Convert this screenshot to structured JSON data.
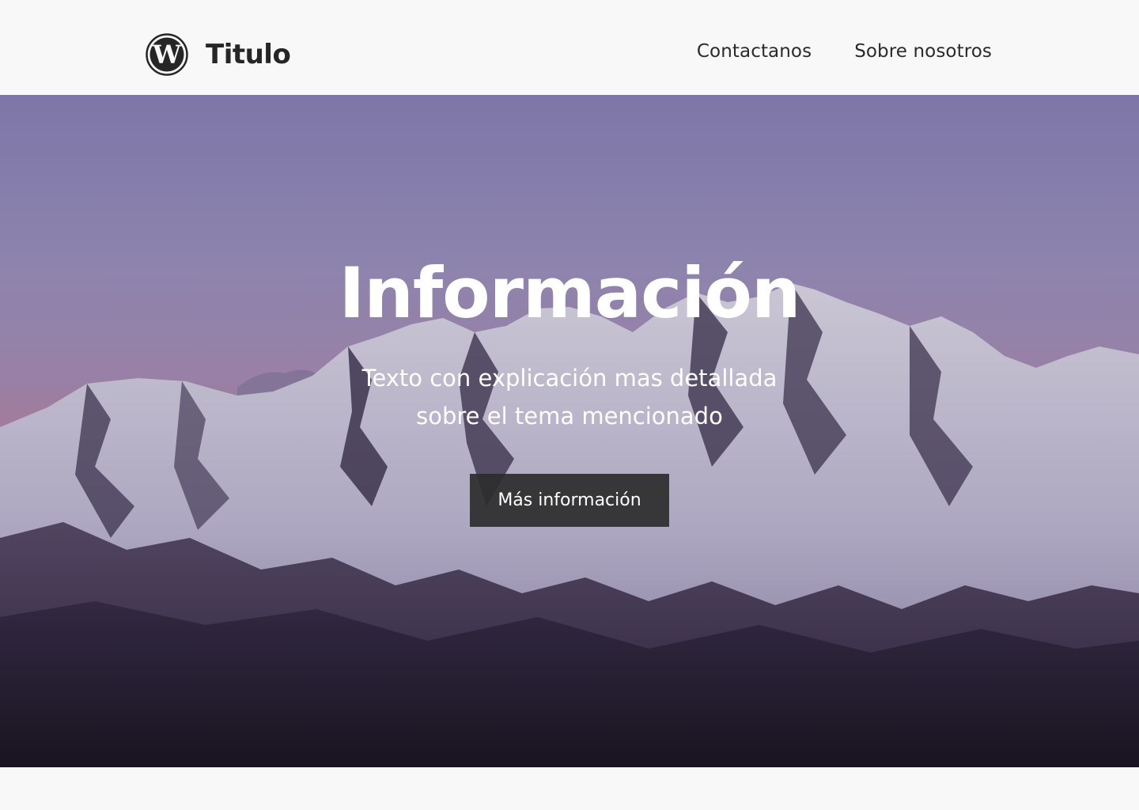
{
  "header": {
    "logo_icon": "wordpress-logo-icon",
    "title": "Titulo",
    "nav": [
      {
        "label": "Contactanos"
      },
      {
        "label": "Sobre nosotros"
      }
    ]
  },
  "hero": {
    "background": "mountain-sunset-photo",
    "title": "Información",
    "subtitle_line1": "Texto con explicación mas detallada",
    "subtitle_line2": "sobre el tema mencionado",
    "cta_label": "Más información"
  },
  "colors": {
    "header_bg": "#f8f8f8",
    "text_dark": "#262626",
    "button_bg": "#2d2d2d",
    "sky_top": "#978fc4",
    "sky_bottom": "#b98aae",
    "mountain_dark": "#2a2035"
  }
}
